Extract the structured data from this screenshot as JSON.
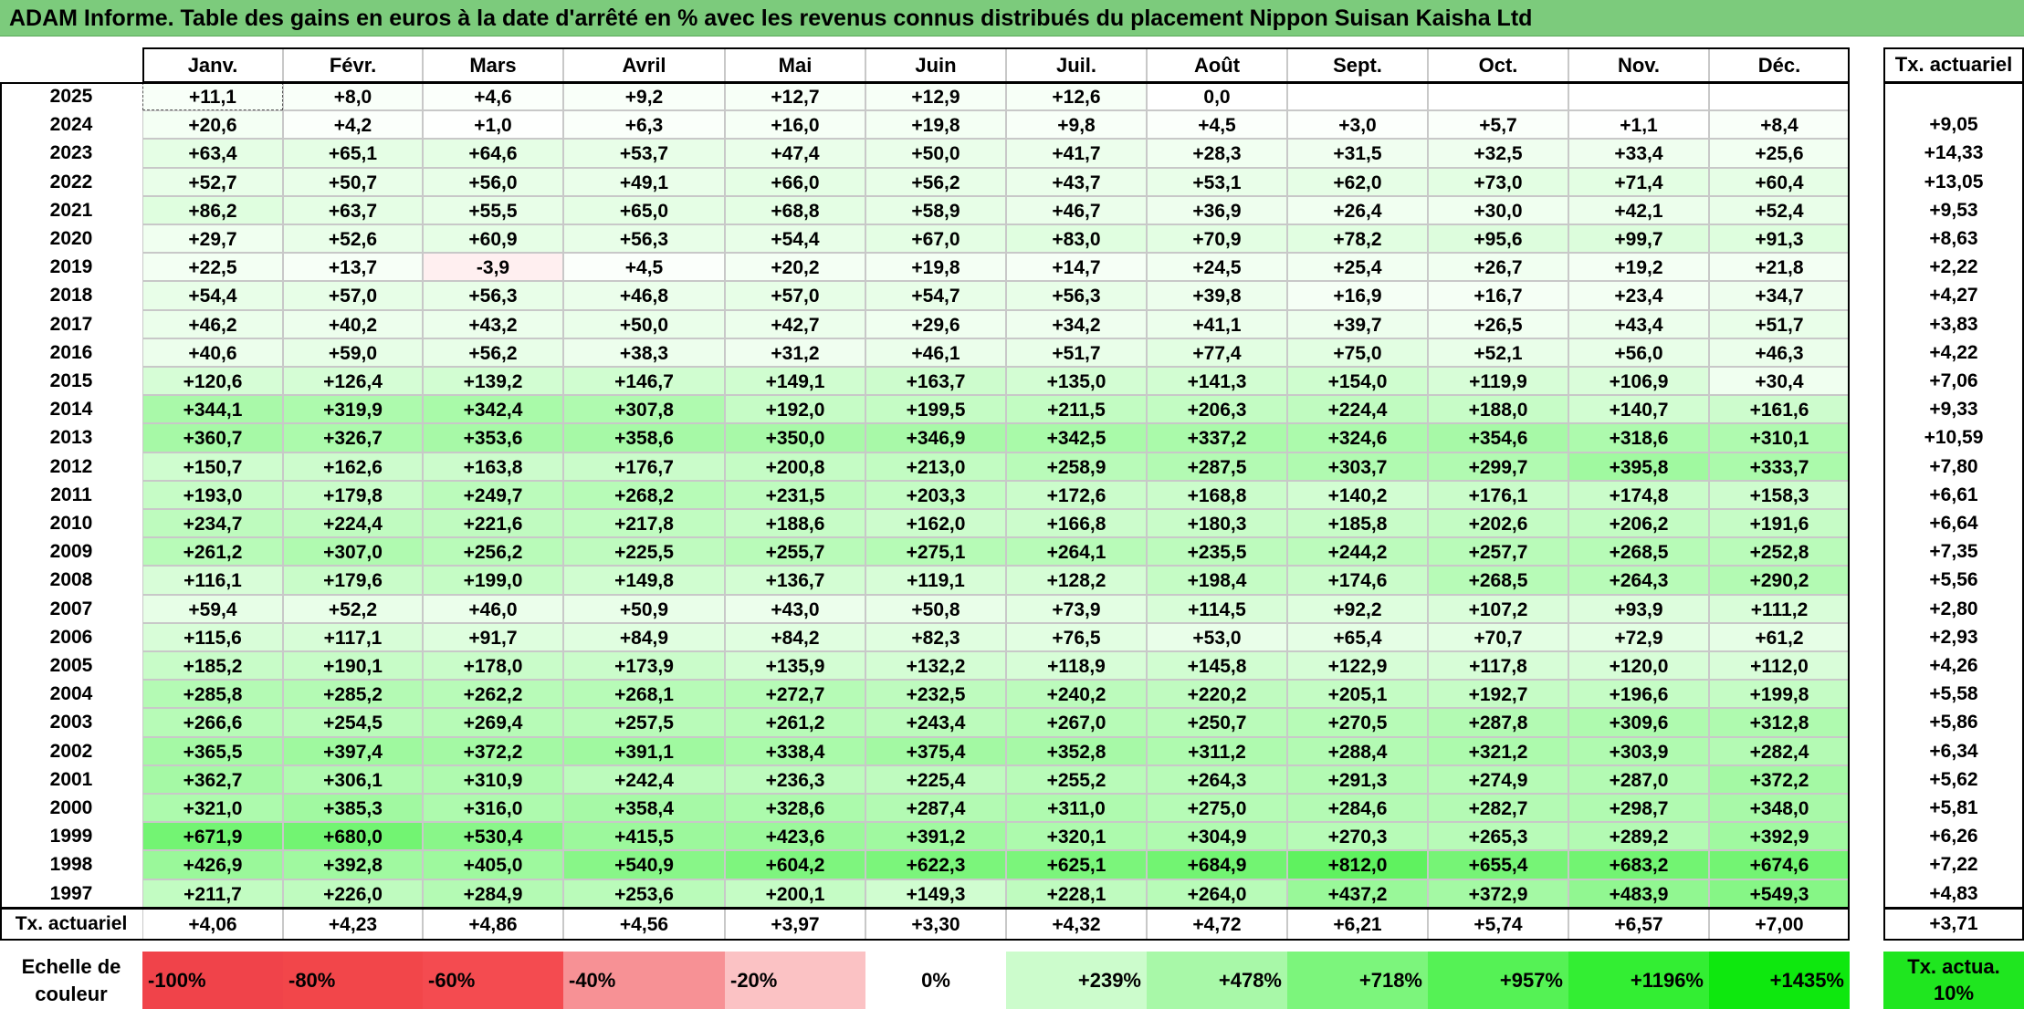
{
  "title": "ADAM Informe. Table des gains en euros à la date d'arrêté en % avec les revenus connus distribués du placement Nippon Suisan Kaisha Ltd",
  "months": [
    "Janv.",
    "Févr.",
    "Mars",
    "Avril",
    "Mai",
    "Juin",
    "Juil.",
    "Août",
    "Sept.",
    "Oct.",
    "Nov.",
    "Déc."
  ],
  "tx_header": "Tx. actuariel",
  "rows": [
    {
      "year": "2025",
      "values": [
        "+11,1",
        "+8,0",
        "+4,6",
        "+9,2",
        "+12,7",
        "+12,9",
        "+12,6",
        "0,0",
        "",
        "",
        "",
        ""
      ],
      "tx": ""
    },
    {
      "year": "2024",
      "values": [
        "+20,6",
        "+4,2",
        "+1,0",
        "+6,3",
        "+16,0",
        "+19,8",
        "+9,8",
        "+4,5",
        "+3,0",
        "+5,7",
        "+1,1",
        "+8,4"
      ],
      "tx": "+9,05"
    },
    {
      "year": "2023",
      "values": [
        "+63,4",
        "+65,1",
        "+64,6",
        "+53,7",
        "+47,4",
        "+50,0",
        "+41,7",
        "+28,3",
        "+31,5",
        "+32,5",
        "+33,4",
        "+25,6"
      ],
      "tx": "+14,33"
    },
    {
      "year": "2022",
      "values": [
        "+52,7",
        "+50,7",
        "+56,0",
        "+49,1",
        "+66,0",
        "+56,2",
        "+43,7",
        "+53,1",
        "+62,0",
        "+73,0",
        "+71,4",
        "+60,4"
      ],
      "tx": "+13,05"
    },
    {
      "year": "2021",
      "values": [
        "+86,2",
        "+63,7",
        "+55,5",
        "+65,0",
        "+68,8",
        "+58,9",
        "+46,7",
        "+36,9",
        "+26,4",
        "+30,0",
        "+42,1",
        "+52,4"
      ],
      "tx": "+9,53"
    },
    {
      "year": "2020",
      "values": [
        "+29,7",
        "+52,6",
        "+60,9",
        "+56,3",
        "+54,4",
        "+67,0",
        "+83,0",
        "+70,9",
        "+78,2",
        "+95,6",
        "+99,7",
        "+91,3"
      ],
      "tx": "+8,63"
    },
    {
      "year": "2019",
      "values": [
        "+22,5",
        "+13,7",
        "-3,9",
        "+4,5",
        "+20,2",
        "+19,8",
        "+14,7",
        "+24,5",
        "+25,4",
        "+26,7",
        "+19,2",
        "+21,8"
      ],
      "tx": "+2,22"
    },
    {
      "year": "2018",
      "values": [
        "+54,4",
        "+57,0",
        "+56,3",
        "+46,8",
        "+57,0",
        "+54,7",
        "+56,3",
        "+39,8",
        "+16,9",
        "+16,7",
        "+23,4",
        "+34,7"
      ],
      "tx": "+4,27"
    },
    {
      "year": "2017",
      "values": [
        "+46,2",
        "+40,2",
        "+43,2",
        "+50,0",
        "+42,7",
        "+29,6",
        "+34,2",
        "+41,1",
        "+39,7",
        "+26,5",
        "+43,4",
        "+51,7"
      ],
      "tx": "+3,83"
    },
    {
      "year": "2016",
      "values": [
        "+40,6",
        "+59,0",
        "+56,2",
        "+38,3",
        "+31,2",
        "+46,1",
        "+51,7",
        "+77,4",
        "+75,0",
        "+52,1",
        "+56,0",
        "+46,3"
      ],
      "tx": "+4,22"
    },
    {
      "year": "2015",
      "values": [
        "+120,6",
        "+126,4",
        "+139,2",
        "+146,7",
        "+149,1",
        "+163,7",
        "+135,0",
        "+141,3",
        "+154,0",
        "+119,9",
        "+106,9",
        "+30,4"
      ],
      "tx": "+7,06"
    },
    {
      "year": "2014",
      "values": [
        "+344,1",
        "+319,9",
        "+342,4",
        "+307,8",
        "+192,0",
        "+199,5",
        "+211,5",
        "+206,3",
        "+224,4",
        "+188,0",
        "+140,7",
        "+161,6"
      ],
      "tx": "+9,33"
    },
    {
      "year": "2013",
      "values": [
        "+360,7",
        "+326,7",
        "+353,6",
        "+358,6",
        "+350,0",
        "+346,9",
        "+342,5",
        "+337,2",
        "+324,6",
        "+354,6",
        "+318,6",
        "+310,1"
      ],
      "tx": "+10,59"
    },
    {
      "year": "2012",
      "values": [
        "+150,7",
        "+162,6",
        "+163,8",
        "+176,7",
        "+200,8",
        "+213,0",
        "+258,9",
        "+287,5",
        "+303,7",
        "+299,7",
        "+395,8",
        "+333,7"
      ],
      "tx": "+7,80"
    },
    {
      "year": "2011",
      "values": [
        "+193,0",
        "+179,8",
        "+249,7",
        "+268,2",
        "+231,5",
        "+203,3",
        "+172,6",
        "+168,8",
        "+140,2",
        "+176,1",
        "+174,8",
        "+158,3"
      ],
      "tx": "+6,61"
    },
    {
      "year": "2010",
      "values": [
        "+234,7",
        "+224,4",
        "+221,6",
        "+217,8",
        "+188,6",
        "+162,0",
        "+166,8",
        "+180,3",
        "+185,8",
        "+202,6",
        "+206,2",
        "+191,6"
      ],
      "tx": "+6,64"
    },
    {
      "year": "2009",
      "values": [
        "+261,2",
        "+307,0",
        "+256,2",
        "+225,5",
        "+255,7",
        "+275,1",
        "+264,1",
        "+235,5",
        "+244,2",
        "+257,7",
        "+268,5",
        "+252,8"
      ],
      "tx": "+7,35"
    },
    {
      "year": "2008",
      "values": [
        "+116,1",
        "+179,6",
        "+199,0",
        "+149,8",
        "+136,7",
        "+119,1",
        "+128,2",
        "+198,4",
        "+174,6",
        "+268,5",
        "+264,3",
        "+290,2"
      ],
      "tx": "+5,56"
    },
    {
      "year": "2007",
      "values": [
        "+59,4",
        "+52,2",
        "+46,0",
        "+50,9",
        "+43,0",
        "+50,8",
        "+73,9",
        "+114,5",
        "+92,2",
        "+107,2",
        "+93,9",
        "+111,2"
      ],
      "tx": "+2,80"
    },
    {
      "year": "2006",
      "values": [
        "+115,6",
        "+117,1",
        "+91,7",
        "+84,9",
        "+84,2",
        "+82,3",
        "+76,5",
        "+53,0",
        "+65,4",
        "+70,7",
        "+72,9",
        "+61,2"
      ],
      "tx": "+2,93"
    },
    {
      "year": "2005",
      "values": [
        "+185,2",
        "+190,1",
        "+178,0",
        "+173,9",
        "+135,9",
        "+132,2",
        "+118,9",
        "+145,8",
        "+122,9",
        "+117,8",
        "+120,0",
        "+112,0"
      ],
      "tx": "+4,26"
    },
    {
      "year": "2004",
      "values": [
        "+285,8",
        "+285,2",
        "+262,2",
        "+268,1",
        "+272,7",
        "+232,5",
        "+240,2",
        "+220,2",
        "+205,1",
        "+192,7",
        "+196,6",
        "+199,8"
      ],
      "tx": "+5,58"
    },
    {
      "year": "2003",
      "values": [
        "+266,6",
        "+254,5",
        "+269,4",
        "+257,5",
        "+261,2",
        "+243,4",
        "+267,0",
        "+250,7",
        "+270,5",
        "+287,8",
        "+309,6",
        "+312,8"
      ],
      "tx": "+5,86"
    },
    {
      "year": "2002",
      "values": [
        "+365,5",
        "+397,4",
        "+372,2",
        "+391,1",
        "+338,4",
        "+375,4",
        "+352,8",
        "+311,2",
        "+288,4",
        "+321,2",
        "+303,9",
        "+282,4"
      ],
      "tx": "+6,34"
    },
    {
      "year": "2001",
      "values": [
        "+362,7",
        "+306,1",
        "+310,9",
        "+242,4",
        "+236,3",
        "+225,4",
        "+255,2",
        "+264,3",
        "+291,3",
        "+274,9",
        "+287,0",
        "+372,2"
      ],
      "tx": "+5,62"
    },
    {
      "year": "2000",
      "values": [
        "+321,0",
        "+385,3",
        "+316,0",
        "+358,4",
        "+328,6",
        "+287,4",
        "+311,0",
        "+275,0",
        "+284,6",
        "+282,7",
        "+298,7",
        "+348,0"
      ],
      "tx": "+5,81"
    },
    {
      "year": "1999",
      "values": [
        "+671,9",
        "+680,0",
        "+530,4",
        "+415,5",
        "+423,6",
        "+391,2",
        "+320,1",
        "+304,9",
        "+270,3",
        "+265,3",
        "+289,2",
        "+392,9"
      ],
      "tx": "+6,26"
    },
    {
      "year": "1998",
      "values": [
        "+426,9",
        "+392,8",
        "+405,0",
        "+540,9",
        "+604,2",
        "+622,3",
        "+625,1",
        "+684,9",
        "+812,0",
        "+655,4",
        "+683,2",
        "+674,6"
      ],
      "tx": "+7,22"
    },
    {
      "year": "1997",
      "values": [
        "+211,7",
        "+226,0",
        "+284,9",
        "+253,6",
        "+200,1",
        "+149,3",
        "+228,1",
        "+264,0",
        "+437,2",
        "+372,9",
        "+483,9",
        "+549,3"
      ],
      "tx": "+4,83"
    }
  ],
  "footer": {
    "label": "Tx. actuariel",
    "values": [
      "+4,06",
      "+4,23",
      "+4,86",
      "+4,56",
      "+3,97",
      "+3,30",
      "+4,32",
      "+4,72",
      "+6,21",
      "+5,74",
      "+6,57",
      "+7,00"
    ],
    "tx": "+3,71"
  },
  "scale": {
    "label": "Echelle de couleur",
    "items": [
      {
        "text": "-100%",
        "color": "#f0434a"
      },
      {
        "text": "-80%",
        "color": "#f2464a"
      },
      {
        "text": "-60%",
        "color": "#f44b50"
      },
      {
        "text": "-40%",
        "color": "#f79195"
      },
      {
        "text": "-20%",
        "color": "#fbc2c4"
      },
      {
        "text": "0%",
        "color": "#ffffff"
      },
      {
        "text": "+239%",
        "color": "#ccfccc"
      },
      {
        "text": "+478%",
        "color": "#a8f8a8"
      },
      {
        "text": "+718%",
        "color": "#7cf57c"
      },
      {
        "text": "+957%",
        "color": "#55f255"
      },
      {
        "text": "+1196%",
        "color": "#33ee33"
      },
      {
        "text": "+1435%",
        "color": "#0ee80e"
      }
    ],
    "tx_text": "Tx. actua. 10%",
    "tx_color": "#1fe61f"
  },
  "colors": {
    "title_bg": "#7ccb7c",
    "negative_light": "#fde3e4",
    "positive_max": "#0ee80e"
  }
}
